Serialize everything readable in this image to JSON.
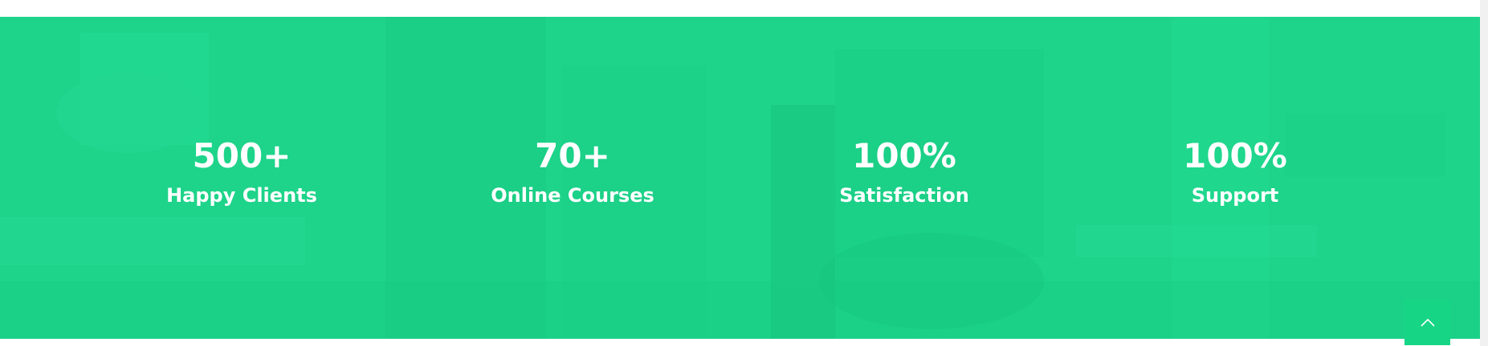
{
  "stats": [
    {
      "number": "500+",
      "label": "Happy Clients"
    },
    {
      "number": "70+",
      "label": "Online Courses"
    },
    {
      "number": "100%",
      "label": "Satisfaction"
    },
    {
      "number": "100%",
      "label": "Support"
    }
  ],
  "back_to_top": {
    "icon": "chevron-up-icon"
  },
  "colors": {
    "accent": "#1ed48a",
    "text": "#ffffff",
    "button": "#16d585"
  }
}
